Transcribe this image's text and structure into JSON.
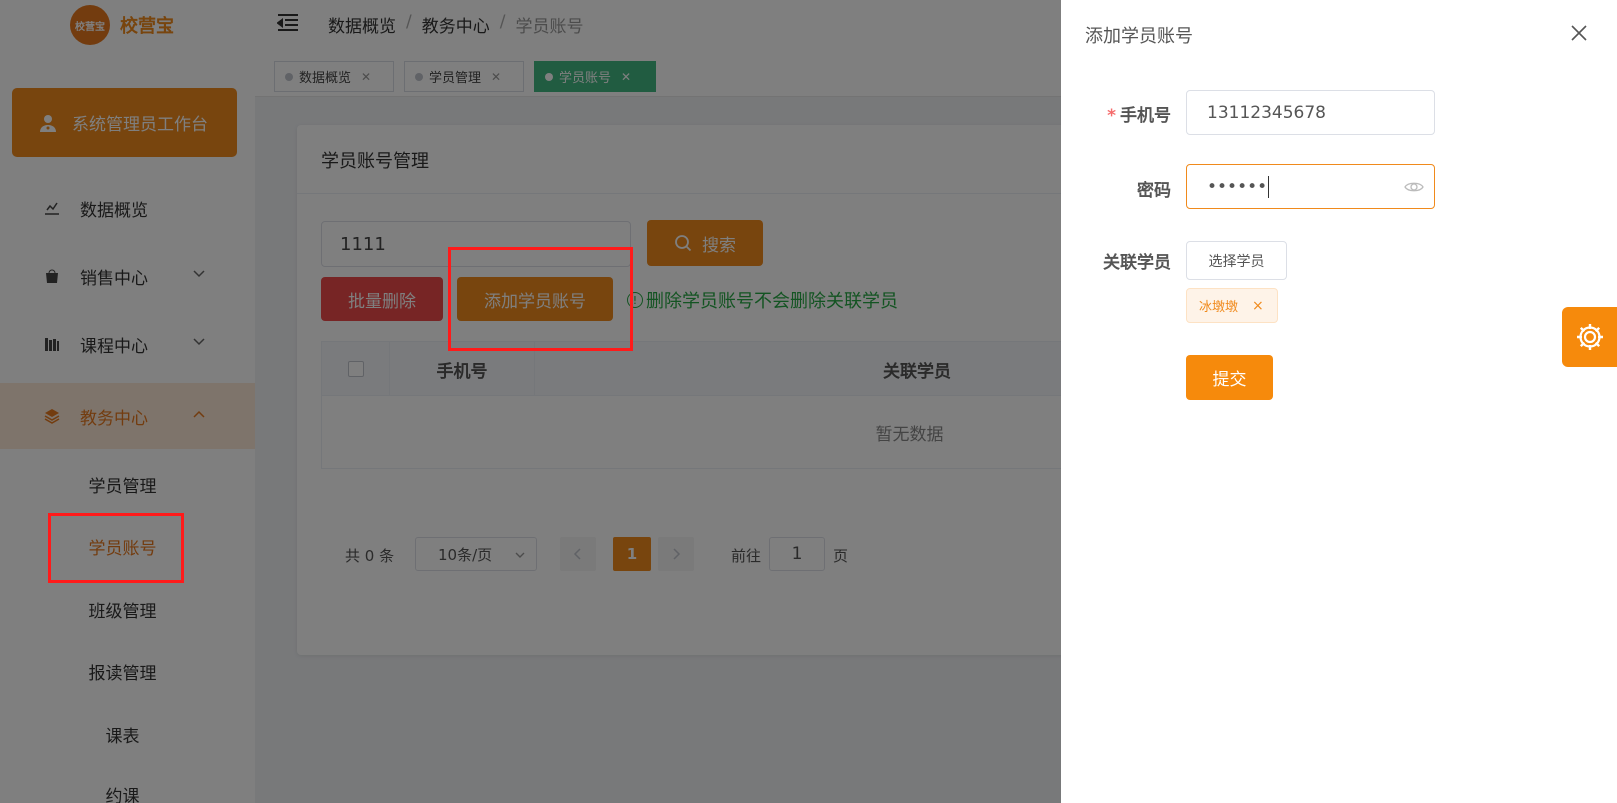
{
  "app": {
    "logo_text": "校营宝",
    "logo_badge": "校营宝"
  },
  "sidebar": {
    "workbench": "系统管理员工作台",
    "items": [
      {
        "label": "数据概览",
        "icon": "chart-icon"
      },
      {
        "label": "销售中心",
        "icon": "bag-icon"
      },
      {
        "label": "课程中心",
        "icon": "books-icon"
      },
      {
        "label": "教务中心",
        "icon": "layers-icon"
      }
    ],
    "sub_items": [
      "学员管理",
      "学员账号",
      "班级管理",
      "报读管理",
      "课表",
      "约课"
    ]
  },
  "header": {
    "breadcrumb": [
      "数据概览",
      "教务中心",
      "学员账号"
    ],
    "separator": "/"
  },
  "tabs": [
    {
      "label": "数据概览"
    },
    {
      "label": "学员管理"
    },
    {
      "label": "学员账号"
    }
  ],
  "main": {
    "title": "学员账号管理",
    "search_value": "1111",
    "search_label": "搜索",
    "batch_delete_label": "批量删除",
    "add_label": "添加学员账号",
    "hint": "删除学员账号不会删除关联学员",
    "hint_icon": "!",
    "columns": [
      "手机号",
      "关联学员"
    ],
    "empty_text": "暂无数据",
    "pagination": {
      "total": "共 0 条",
      "page_size": "10条/页",
      "current_page": "1",
      "goto_label": "前往",
      "goto_value": "1",
      "page_suffix": "页"
    }
  },
  "drawer": {
    "title": "添加学员账号",
    "required_mark": "*",
    "phone_label": "手机号",
    "phone_value": "13112345678",
    "password_label": "密码",
    "password_value": "••••••",
    "related_label": "关联学员",
    "choose_label": "选择学员",
    "tag_label": "冰墩墩",
    "tag_close": "×",
    "submit_label": "提交"
  },
  "colors": {
    "accent": "#f08a1c",
    "danger": "#ee4a4a",
    "success": "#27a844",
    "tab_active": "#42b983",
    "annotation": "#ff1a1a"
  }
}
